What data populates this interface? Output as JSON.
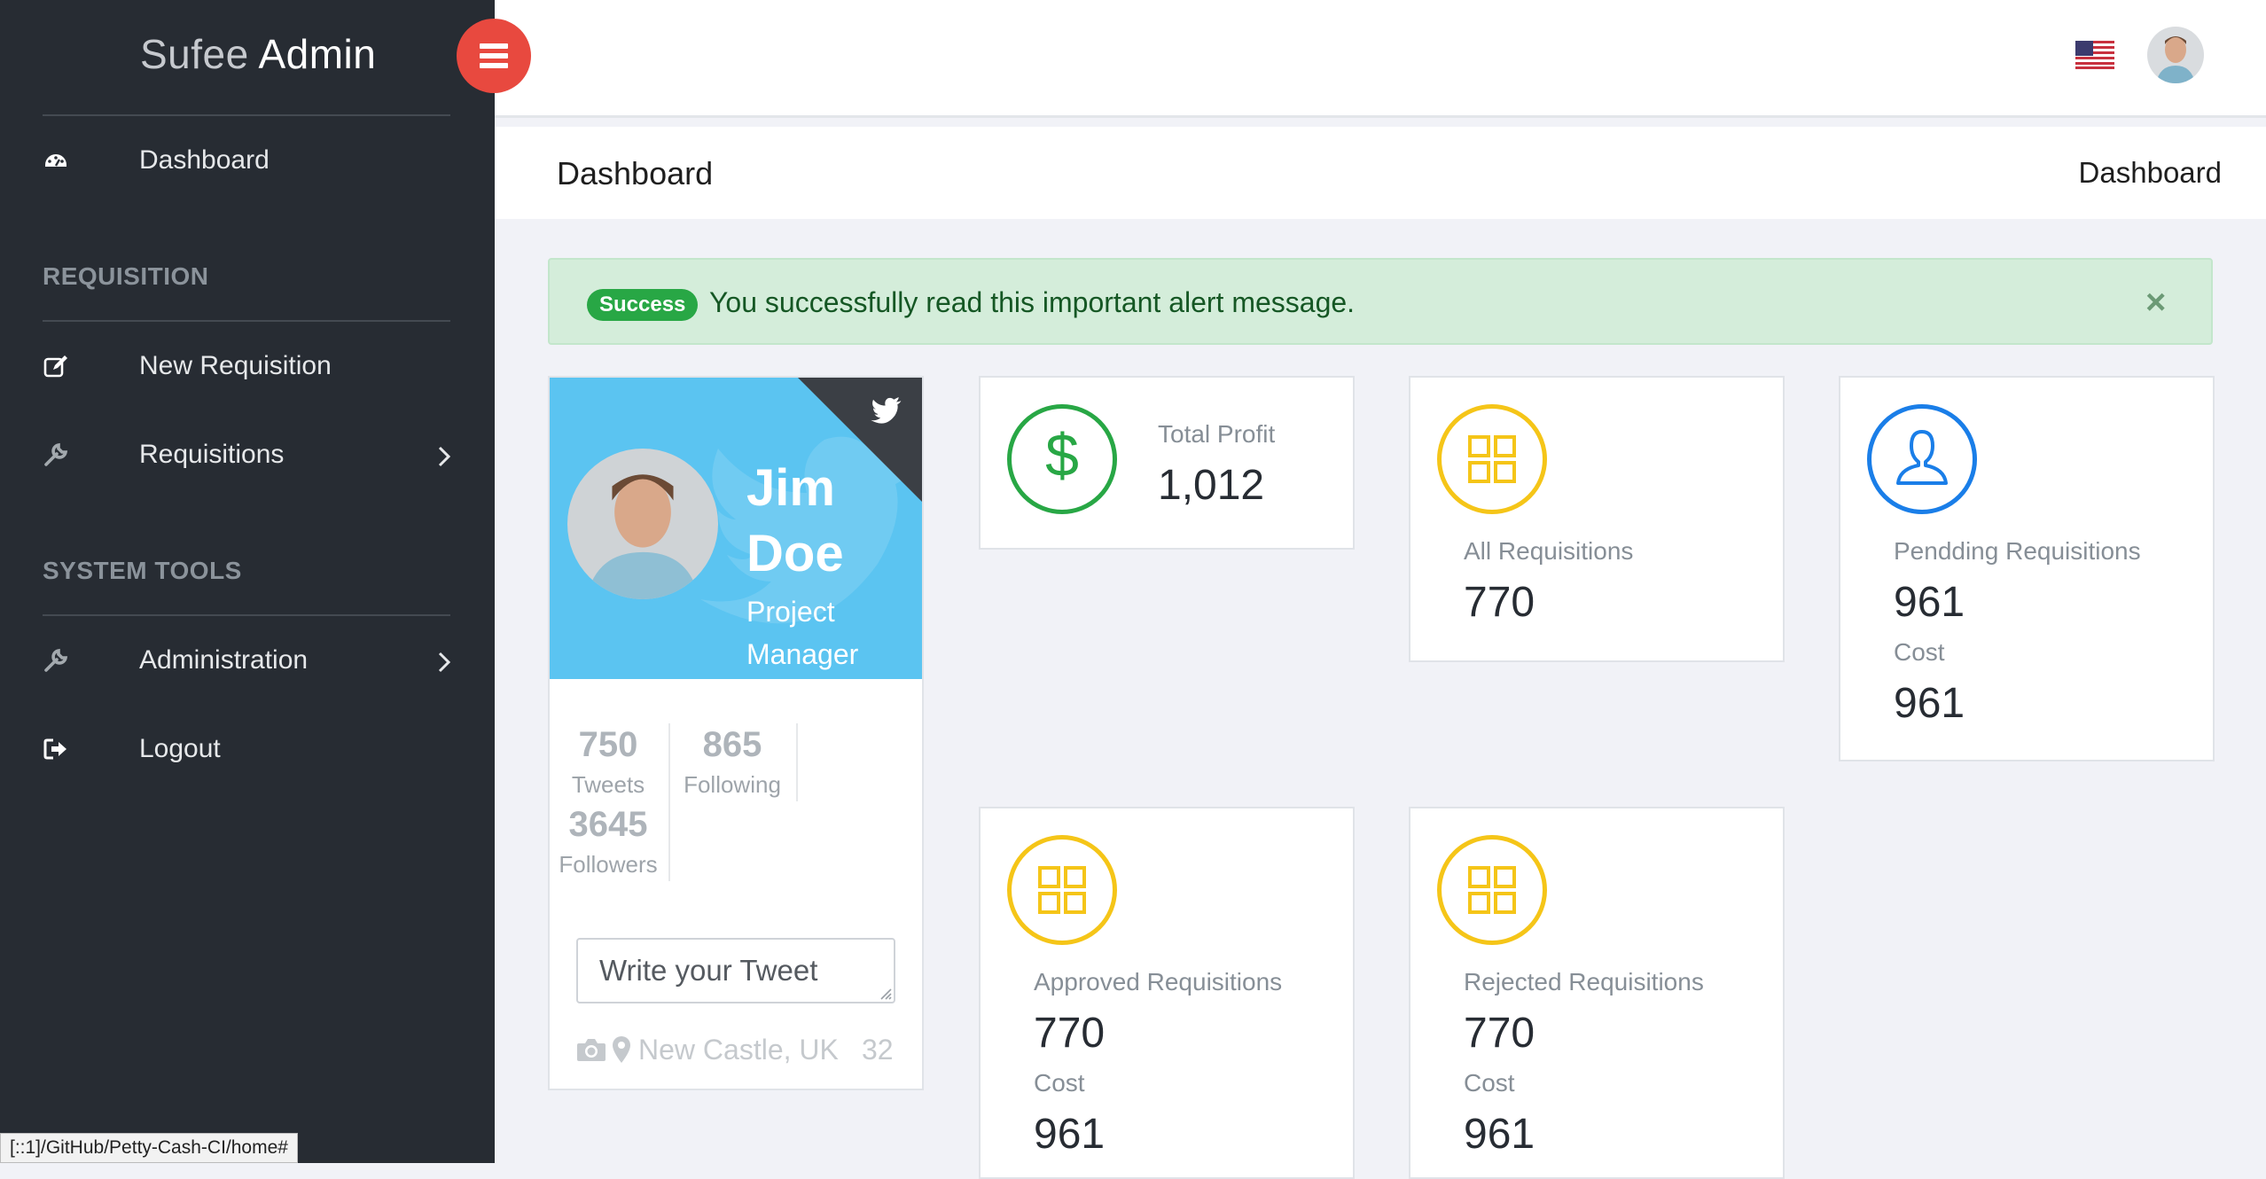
{
  "brand": {
    "light": "Sufee",
    "bold": "Admin"
  },
  "sidebar": {
    "items": [
      {
        "label": "Dashboard",
        "icon": "dashboard-icon"
      },
      {
        "label": "New Requisition",
        "icon": "edit-icon"
      },
      {
        "label": "Requisitions",
        "icon": "wrench-icon"
      },
      {
        "label": "Administration",
        "icon": "wrench-icon"
      },
      {
        "label": "Logout",
        "icon": "logout-icon"
      }
    ],
    "sections": [
      "REQUISITION",
      "SYSTEM TOOLS"
    ]
  },
  "header": {
    "page_title": "Dashboard",
    "breadcrumb": "Dashboard"
  },
  "alert": {
    "badge": "Success",
    "message": "You successfully read this important alert message.",
    "close": "×"
  },
  "profile": {
    "first_name": "Jim",
    "last_name": "Doe",
    "role_1": "Project",
    "role_2": "Manager",
    "tweets": "750",
    "tweets_label": "Tweets",
    "following": "865",
    "following_label": "Following",
    "followers": "3645",
    "followers_label": "Followers",
    "tweet_placeholder": "Write your Tweet",
    "location": "New Castle, UK",
    "count": "32"
  },
  "stats": {
    "total_profit": {
      "label": "Total Profit",
      "value": "1,012"
    },
    "all_requisitions": {
      "label": "All Requisitions",
      "value": "770"
    },
    "pending_requisitions": {
      "label": "Pendding Requisitions",
      "value": "961",
      "cost_label": "Cost",
      "cost": "961"
    },
    "approved_requisitions": {
      "label": "Approved Requisitions",
      "value": "770",
      "cost_label": "Cost",
      "cost": "961"
    },
    "rejected_requisitions": {
      "label": "Rejected Requisitions",
      "value": "770",
      "cost_label": "Cost",
      "cost": "961"
    }
  },
  "status_bar": {
    "url": "[::1]/GitHub/Petty-Cash-CI/home#"
  },
  "colors": {
    "sidebar_bg": "#272c33",
    "toggle_red": "#e8493f",
    "twitter_blue": "#5bc4f1",
    "green": "#28a745",
    "yellow": "#f5c518",
    "blue": "#1a7ee8"
  }
}
